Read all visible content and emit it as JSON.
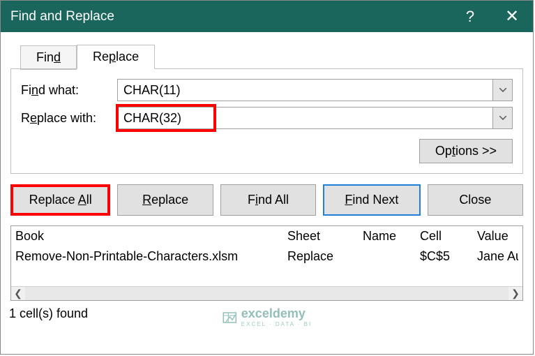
{
  "title": "Find and Replace",
  "tabs": {
    "find": "Find",
    "replace": "Replace"
  },
  "fields": {
    "find_label": "Find what:",
    "find_value": "CHAR(11)",
    "replace_label": "Replace with:",
    "replace_value": "CHAR(32)"
  },
  "options_btn": "Options >>",
  "buttons": {
    "replace_all": "Replace All",
    "replace": "Replace",
    "find_all": "Find All",
    "find_next": "Find Next",
    "close": "Close"
  },
  "results": {
    "headers": {
      "book": "Book",
      "sheet": "Sheet",
      "name": "Name",
      "cell": "Cell",
      "value": "Value"
    },
    "row": {
      "book": "Remove-Non-Printable-Characters.xlsm",
      "sheet": "Replace",
      "name": "",
      "cell": "$C$5",
      "value": "Jane Austin"
    }
  },
  "status": "1 cell(s) found",
  "watermark": {
    "brand": "exceldemy",
    "tag": "EXCEL · DATA · BI"
  }
}
